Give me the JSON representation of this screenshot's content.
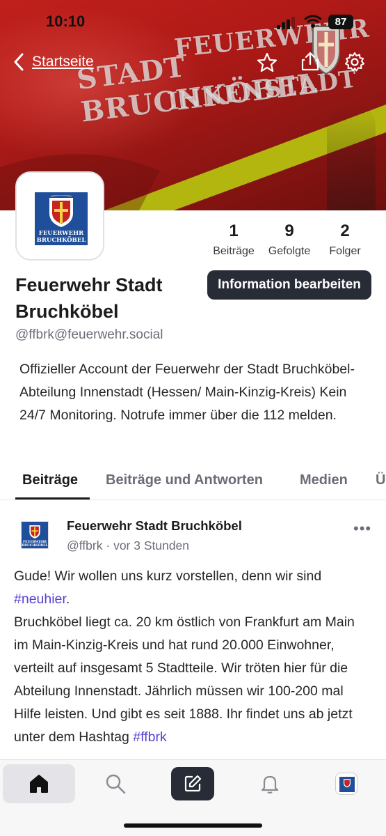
{
  "status_bar": {
    "time": "10:10",
    "battery": "87"
  },
  "banner": {
    "lettering": [
      "FEUERWEHR",
      "STADT BRUCHKÖBEL",
      "INNENSTADT"
    ]
  },
  "nav": {
    "back_label": "Startseite",
    "icons": [
      "chevron-left-icon",
      "star-icon",
      "share-icon",
      "gear-icon"
    ]
  },
  "profile": {
    "avatar_text": [
      "FEUERWEHR",
      "BRUCHKÖBEL"
    ],
    "name_line1": "Feuerwehr Stadt",
    "name_line2": "Bruchköbel",
    "handle": "@ffbrk@feuerwehr.social",
    "edit_button": "Information bearbeiten",
    "bio": "Offizieller Account der Feuerwehr der Stadt Bruchköbel-Abteilung Innenstadt (Hessen/ Main-Kinzig-Kreis) Kein 24/7 Monitoring. Notrufe immer über die 112 melden."
  },
  "stats": [
    {
      "value": "1",
      "label": "Beiträge"
    },
    {
      "value": "9",
      "label": "Gefolgte"
    },
    {
      "value": "2",
      "label": "Folger"
    }
  ],
  "tabs": [
    {
      "label": "Beiträge",
      "active": true
    },
    {
      "label": "Beiträge und Antworten",
      "active": false
    },
    {
      "label": "Medien",
      "active": false
    },
    {
      "label": "Ü",
      "active": false
    }
  ],
  "post": {
    "author": "Feuerwehr Stadt Bruchköbel",
    "handle": "@ffbrk",
    "separator": "·",
    "time": "vor 3 Stunden",
    "more": "•••",
    "text_1": "Gude! Wir wollen uns kurz vorstellen, denn wir sind ",
    "hashtag_1": "#neuhier",
    "text_2": ".",
    "text_3": "Bruchköbel liegt ca. 20 km östlich von Frankfurt am Main im Main-Kinzig-Kreis und hat rund 20.000 Einwohner, verteilt auf insgesamt 5 Stadtteile. Wir tröten hier für die Abteilung Innenstadt. Jährlich müssen wir 100-200 mal Hilfe leisten. Und gibt es seit 1888. Ihr findet uns ab jetzt unter dem Hashtag ",
    "hashtag_2": "#ffbrk"
  },
  "tabbar": {
    "items": [
      "home-icon",
      "search-icon",
      "compose-icon",
      "bell-icon",
      "profile-avatar"
    ]
  },
  "colors": {
    "accent_dark": "#282c37",
    "hashtag": "#5b3fd1",
    "banner_red": "#b01a17"
  }
}
